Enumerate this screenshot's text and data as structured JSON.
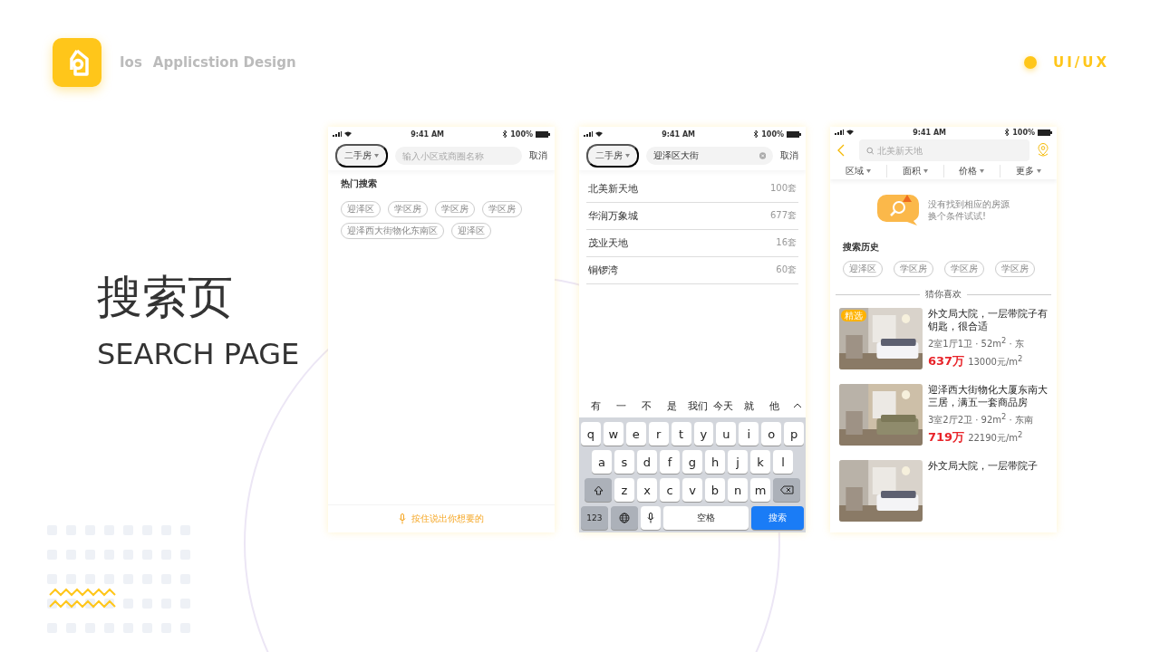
{
  "header": {
    "subtitle": "Ios",
    "title": "Applicstion Design",
    "tag": "UI/UX"
  },
  "heading": {
    "zh": "搜索页",
    "en": "SEARCH PAGE"
  },
  "phones": [
    {
      "kind": "hot",
      "status": {
        "time": "9:41 AM",
        "battery": "100%"
      },
      "search_bar": {
        "dropdown": "二手房",
        "placeholder": "输入小区或商圈名称",
        "cancel": "取消"
      },
      "hot_search": {
        "title": "热门搜索",
        "tags": [
          "迎泽区",
          "学区房",
          "学区房",
          "学区房",
          "迎泽西大街物化东南区",
          "迎泽区"
        ]
      },
      "voice_hint": "按住说出你想要的"
    },
    {
      "kind": "suggest",
      "status": {
        "time": "9:41 AM",
        "battery": "100%"
      },
      "search_bar": {
        "dropdown": "二手房",
        "value": "迎泽区大街",
        "cancel": "取消"
      },
      "suggestions": [
        {
          "name": "北美新天地",
          "count": "100套"
        },
        {
          "name": "华润万象城",
          "count": "677套"
        },
        {
          "name": "茂业天地",
          "count": "16套"
        },
        {
          "name": "铜锣湾",
          "count": "60套"
        }
      ],
      "keyboard": {
        "candidates": [
          "有",
          "一",
          "不",
          "是",
          "我们",
          "今天",
          "就",
          "他"
        ],
        "rows": [
          {
            "keys": [
              {
                "kind": "letter",
                "label": "q"
              },
              {
                "kind": "letter",
                "label": "w"
              },
              {
                "kind": "letter",
                "label": "e"
              },
              {
                "kind": "letter",
                "label": "r"
              },
              {
                "kind": "letter",
                "label": "t"
              },
              {
                "kind": "letter",
                "label": "y"
              },
              {
                "kind": "letter",
                "label": "u"
              },
              {
                "kind": "letter",
                "label": "i"
              },
              {
                "kind": "letter",
                "label": "o"
              },
              {
                "kind": "letter",
                "label": "p"
              }
            ]
          },
          {
            "keys": [
              {
                "kind": "letter",
                "label": "a"
              },
              {
                "kind": "letter",
                "label": "s"
              },
              {
                "kind": "letter",
                "label": "d"
              },
              {
                "kind": "letter",
                "label": "f"
              },
              {
                "kind": "letter",
                "label": "g"
              },
              {
                "kind": "letter",
                "label": "h"
              },
              {
                "kind": "letter",
                "label": "j"
              },
              {
                "kind": "letter",
                "label": "k"
              },
              {
                "kind": "letter",
                "label": "l"
              }
            ]
          },
          {
            "keys": [
              {
                "kind": "shift"
              },
              {
                "kind": "letter",
                "label": "z"
              },
              {
                "kind": "letter",
                "label": "x"
              },
              {
                "kind": "letter",
                "label": "c"
              },
              {
                "kind": "letter",
                "label": "v"
              },
              {
                "kind": "letter",
                "label": "b"
              },
              {
                "kind": "letter",
                "label": "n"
              },
              {
                "kind": "letter",
                "label": "m"
              },
              {
                "kind": "delete"
              }
            ]
          },
          {
            "keys": [
              {
                "kind": "numbers",
                "label": "123"
              },
              {
                "kind": "globe"
              },
              {
                "kind": "mic"
              },
              {
                "kind": "space",
                "label": "空格"
              },
              {
                "kind": "search",
                "label": "搜索"
              }
            ]
          }
        ]
      }
    },
    {
      "kind": "results",
      "status": {
        "time": "9:41 AM",
        "battery": "100%"
      },
      "search_bar": {
        "placeholder": "北美新天地"
      },
      "filters": [
        "区域",
        "面积",
        "价格",
        "更多"
      ],
      "empty_state": [
        "没有找到相应的房源",
        "换个条件试试!"
      ],
      "history": {
        "title": "搜索历史",
        "tags": [
          "迎泽区",
          "学区房",
          "学区房",
          "学区房"
        ]
      },
      "recommend": {
        "title": "猜你喜欢",
        "listings": [
          {
            "badge": "精选",
            "title": "外文局大院，一层带院子有钥匙，很合适",
            "info": "2室1厅1卫 · 52m$^{2}$ · 东",
            "price": "637万",
            "unit_price": "13000元/m$^{2}$"
          },
          {
            "title": "迎泽西大街物化大厦东南大三居，满五一套商品房",
            "info": "3室2厅2卫 · 92m$^{2}$ · 东南",
            "price": "719万",
            "unit_price": "22190元/m$^{2}$"
          },
          {
            "title": "外文局大院，一层带院子"
          }
        ]
      }
    }
  ]
}
